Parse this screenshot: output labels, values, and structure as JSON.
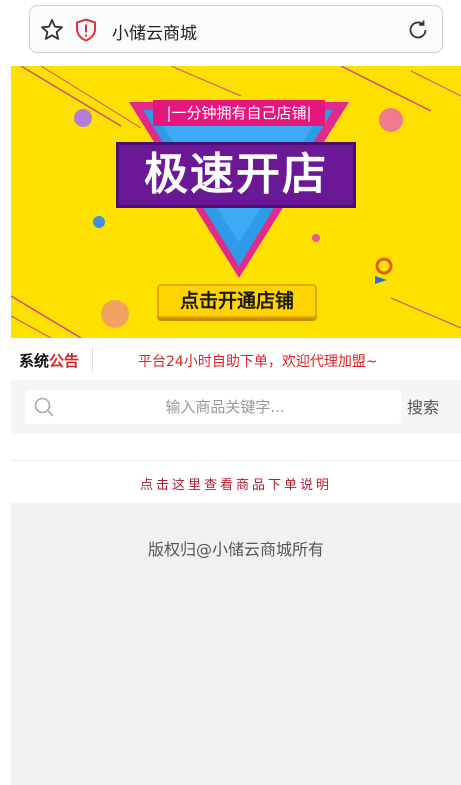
{
  "browser": {
    "url_text": "小储云商城",
    "icons": {
      "bookmark": "star-icon",
      "security": "shield-alert-icon",
      "reload": "reload-icon"
    }
  },
  "banner": {
    "tagline": "|一分钟拥有自己店铺|",
    "headline": "极速开店",
    "cta_label": "点击开通店铺"
  },
  "notice": {
    "label_part1": "系统",
    "label_part2": "公告",
    "message": "平台24小时自助下单，欢迎代理加盟~"
  },
  "search": {
    "placeholder": "输入商品关键字...",
    "value": "",
    "button_label": "搜索"
  },
  "guide": {
    "link_text": "点击这里查看商品下单说明"
  },
  "footer": {
    "copyright": "版权归@小储云商城所有"
  },
  "colors": {
    "banner_yellow": "#ffe100",
    "accent_red": "#d8232a",
    "headline_purple": "#6a1896",
    "tagline_pink": "#e5177f"
  }
}
